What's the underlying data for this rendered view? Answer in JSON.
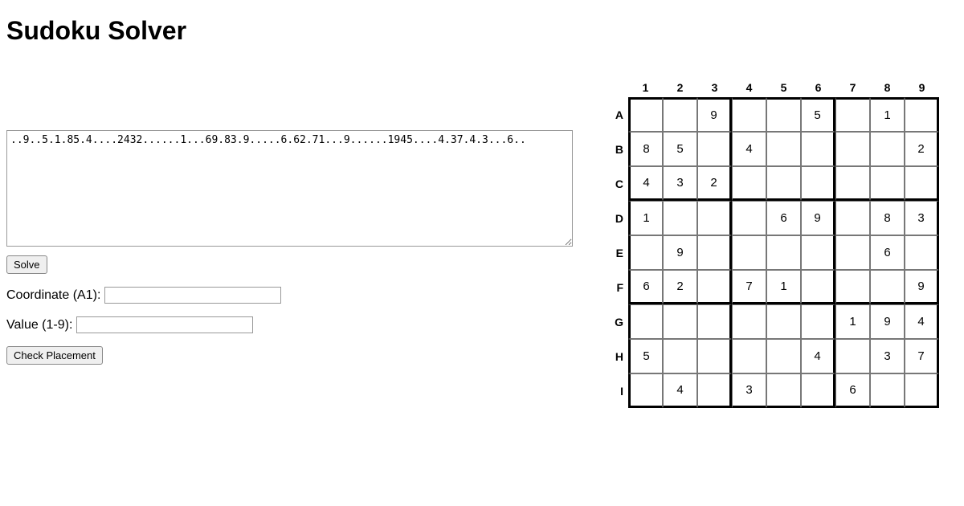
{
  "title": "Sudoku Solver",
  "puzzle_string": "..9..5.1.85.4....2432......1...69.83.9.....6.62.71...9......1945....4.37.4.3...6..",
  "solve_button": "Solve",
  "coord_label": "Coordinate (A1):",
  "coord_value": "",
  "value_label": "Value (1-9):",
  "value_value": "",
  "check_button": "Check Placement",
  "col_headers": [
    "1",
    "2",
    "3",
    "4",
    "5",
    "6",
    "7",
    "8",
    "9"
  ],
  "row_headers": [
    "A",
    "B",
    "C",
    "D",
    "E",
    "F",
    "G",
    "H",
    "I"
  ],
  "grid": [
    [
      "",
      "",
      "9",
      "",
      "",
      "5",
      "",
      "1",
      ""
    ],
    [
      "8",
      "5",
      "",
      "4",
      "",
      "",
      "",
      "",
      "2"
    ],
    [
      "4",
      "3",
      "2",
      "",
      "",
      "",
      "",
      "",
      ""
    ],
    [
      "1",
      "",
      "",
      "",
      "6",
      "9",
      "",
      "8",
      "3"
    ],
    [
      "",
      "9",
      "",
      "",
      "",
      "",
      "",
      "6",
      ""
    ],
    [
      "6",
      "2",
      "",
      "7",
      "1",
      "",
      "",
      "",
      "9"
    ],
    [
      "",
      "",
      "",
      "",
      "",
      "",
      "1",
      "9",
      "4"
    ],
    [
      "5",
      "",
      "",
      "",
      "",
      "4",
      "",
      "3",
      "7"
    ],
    [
      "",
      "4",
      "",
      "3",
      "",
      "",
      "6",
      "",
      ""
    ]
  ]
}
